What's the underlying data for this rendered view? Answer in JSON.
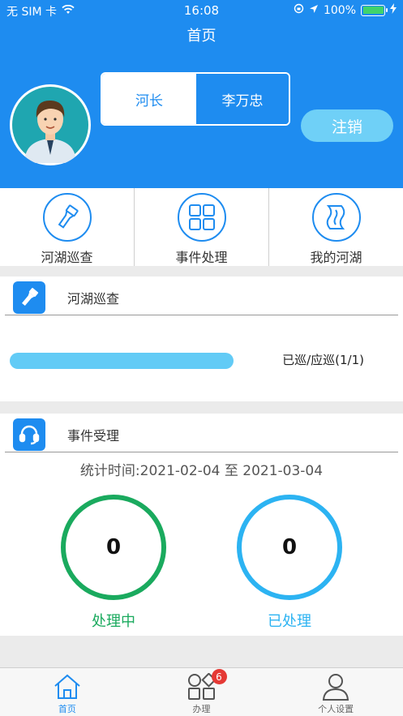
{
  "status_bar": {
    "carrier": "无 SIM 卡",
    "time": "16:08",
    "battery": "100%"
  },
  "nav": {
    "title": "首页"
  },
  "profile": {
    "role_label": "河长",
    "name": "李万忠",
    "logout_label": "注销"
  },
  "menu": [
    {
      "label": "河湖巡查",
      "icon": "flashlight-icon"
    },
    {
      "label": "事件处理",
      "icon": "grid-icon"
    },
    {
      "label": "我的河湖",
      "icon": "river-icon"
    }
  ],
  "patrol": {
    "title": "河湖巡查",
    "status_text": "已巡/应巡(1/1)",
    "progress": 1.0
  },
  "events": {
    "title": "事件受理",
    "date_range": "统计时间:2021-02-04 至 2021-03-04",
    "processing_count": "0",
    "processing_label": "处理中",
    "done_count": "0",
    "done_label": "已处理"
  },
  "tabbar": [
    {
      "label": "首页",
      "active": true
    },
    {
      "label": "办理",
      "badge": "6"
    },
    {
      "label": "个人设置"
    }
  ],
  "colors": {
    "primary": "#1e8cf0",
    "green": "#1aaa5e",
    "cyan": "#2cb3f2",
    "light_blue": "#6fd0f7",
    "badge": "#e53935"
  }
}
